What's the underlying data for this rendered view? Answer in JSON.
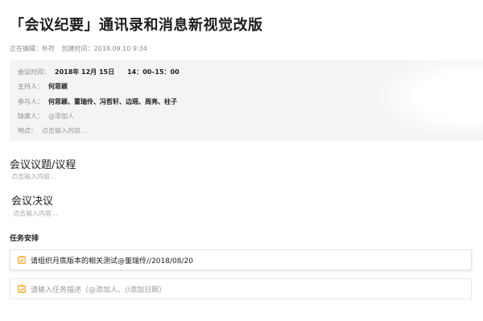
{
  "doc": {
    "title": "「会议纪要」通讯录和消息新视觉改版",
    "meta": {
      "editing": "正在编辑：朴符",
      "created": "创建时间：2018.09.10  9:34"
    }
  },
  "info": {
    "time": {
      "label": "会议时间：",
      "date": "2018年 12月 15日",
      "range": "14：00–15：00"
    },
    "host": {
      "label": "主持人：",
      "value": "何思颖"
    },
    "participants": {
      "label": "参与人：",
      "value": "何思颖、董瑞伶、冯哲轩、边瑶、周亮、柱子"
    },
    "absent": {
      "label": "缺席人：",
      "value": "@添加人"
    },
    "location": {
      "label": "地点：",
      "value": "点击输入内容..."
    }
  },
  "sections": {
    "agenda": {
      "heading": "会议议题/议程",
      "placeholder": "点击输入内容..."
    },
    "resolution": {
      "heading": "会议决议",
      "placeholder": "点击输入内容..."
    }
  },
  "tasks": {
    "heading": "任务安排",
    "items": [
      {
        "text": "请组织月底版本的相关测试@董瑞伶//2018/08/20"
      }
    ],
    "new_placeholder": "请输入任务描述（@添加人、//添加日期）"
  },
  "colors": {
    "accent": "#f2a623",
    "info_bg": "#f4f4f4",
    "muted_text": "#8a8a8a"
  },
  "icons": [
    "task-checkbox-icon"
  ]
}
